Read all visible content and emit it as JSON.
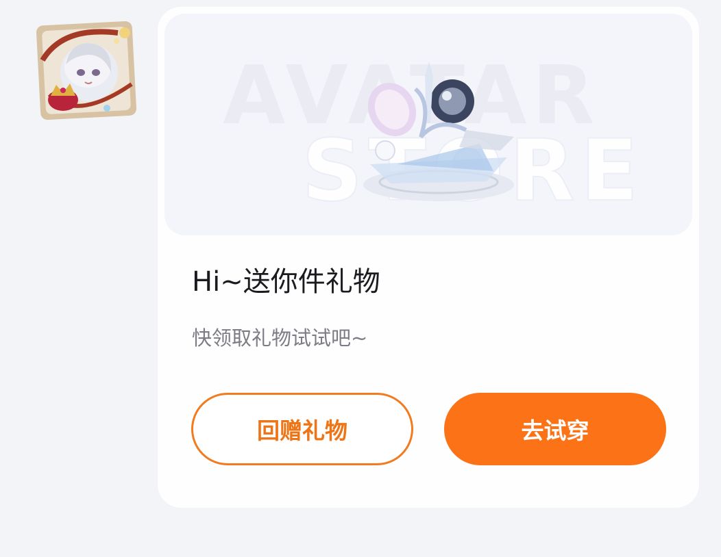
{
  "message": {
    "title": "Hi~送你件礼物",
    "subtitle": "快领取礼物试试吧~"
  },
  "banner": {
    "watermark_line1": "AVATAR",
    "watermark_line2": "STORE"
  },
  "actions": {
    "return_gift_label": "回赠礼物",
    "try_on_label": "去试穿"
  },
  "colors": {
    "accent": "#fb7316",
    "background": "#f3f4f8",
    "card": "#fefeff"
  }
}
